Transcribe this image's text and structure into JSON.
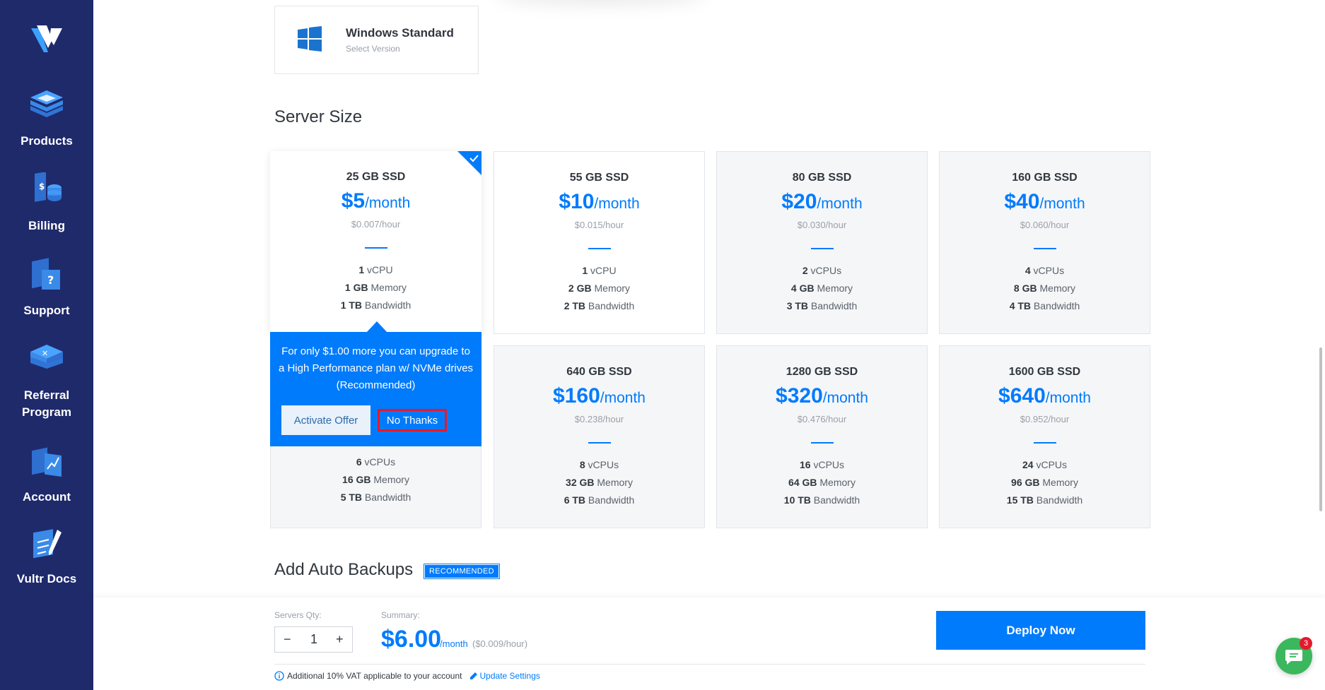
{
  "sidebar": {
    "items": [
      {
        "label": "Products"
      },
      {
        "label": "Billing"
      },
      {
        "label": "Support"
      },
      {
        "label": "Referral Program"
      },
      {
        "label": "Account"
      },
      {
        "label": "Vultr Docs"
      }
    ]
  },
  "os": {
    "title": "Windows Standard",
    "subtitle": "Select Version"
  },
  "server_size": {
    "title": "Server Size",
    "plans": [
      {
        "size": "25 GB SSD",
        "price": "$5",
        "unit": "/month",
        "hour": "$0.007/hour",
        "cpu_n": "1",
        "cpu_t": " vCPU",
        "mem_n": "1 GB",
        "mem_t": " Memory",
        "bw_n": "1 TB",
        "bw_t": " Bandwidth"
      },
      {
        "size": "55 GB SSD",
        "price": "$10",
        "unit": "/month",
        "hour": "$0.015/hour",
        "cpu_n": "1",
        "cpu_t": " vCPU",
        "mem_n": "2 GB",
        "mem_t": " Memory",
        "bw_n": "2 TB",
        "bw_t": " Bandwidth"
      },
      {
        "size": "80 GB SSD",
        "price": "$20",
        "unit": "/month",
        "hour": "$0.030/hour",
        "cpu_n": "2",
        "cpu_t": " vCPUs",
        "mem_n": "4 GB",
        "mem_t": " Memory",
        "bw_n": "3 TB",
        "bw_t": " Bandwidth"
      },
      {
        "size": "160 GB SSD",
        "price": "$40",
        "unit": "/month",
        "hour": "$0.060/hour",
        "cpu_n": "4",
        "cpu_t": " vCPUs",
        "mem_n": "8 GB",
        "mem_t": " Memory",
        "bw_n": "4 TB",
        "bw_t": " Bandwidth"
      },
      {
        "size": "640 GB SSD",
        "price": "$160",
        "unit": "/month",
        "hour": "$0.238/hour",
        "cpu_n": "8",
        "cpu_t": " vCPUs",
        "mem_n": "32 GB",
        "mem_t": " Memory",
        "bw_n": "6 TB",
        "bw_t": " Bandwidth"
      },
      {
        "size": "1280 GB SSD",
        "price": "$320",
        "unit": "/month",
        "hour": "$0.476/hour",
        "cpu_n": "16",
        "cpu_t": " vCPUs",
        "mem_n": "64 GB",
        "mem_t": " Memory",
        "bw_n": "10 TB",
        "bw_t": " Bandwidth"
      },
      {
        "size": "1600 GB SSD",
        "price": "$640",
        "unit": "/month",
        "hour": "$0.952/hour",
        "cpu_n": "24",
        "cpu_t": " vCPUs",
        "mem_n": "96 GB",
        "mem_t": " Memory",
        "bw_n": "15 TB",
        "bw_t": " Bandwidth"
      }
    ],
    "offer": {
      "text": "For only $1.00 more you can upgrade to a High Performance plan w/ NVMe drives (Recommended)",
      "activate_label": "Activate Offer",
      "no_thanks_label": "No Thanks",
      "cpu_n": "6",
      "cpu_t": " vCPUs",
      "mem_n": "16 GB",
      "mem_t": " Memory",
      "bw_n": "5 TB",
      "bw_t": " Bandwidth"
    }
  },
  "backups": {
    "title": "Add Auto Backups",
    "badge": "RECOMMENDED"
  },
  "bottom": {
    "qty_label": "Servers Qty:",
    "qty_value": "1",
    "minus": "−",
    "plus": "+",
    "summary_label": "Summary:",
    "summary_price": "$6.00",
    "summary_month": "/month",
    "summary_hour": "($0.009/hour)",
    "deploy_label": "Deploy Now",
    "vat_text": "Additional 10% VAT applicable to your account",
    "update_link": "Update Settings"
  },
  "chat": {
    "badge_count": "3"
  },
  "colors": {
    "sidebar": "#1f2a6b",
    "accent": "#007bfc",
    "alert": "#e5192b",
    "chat": "#3bb75e"
  }
}
